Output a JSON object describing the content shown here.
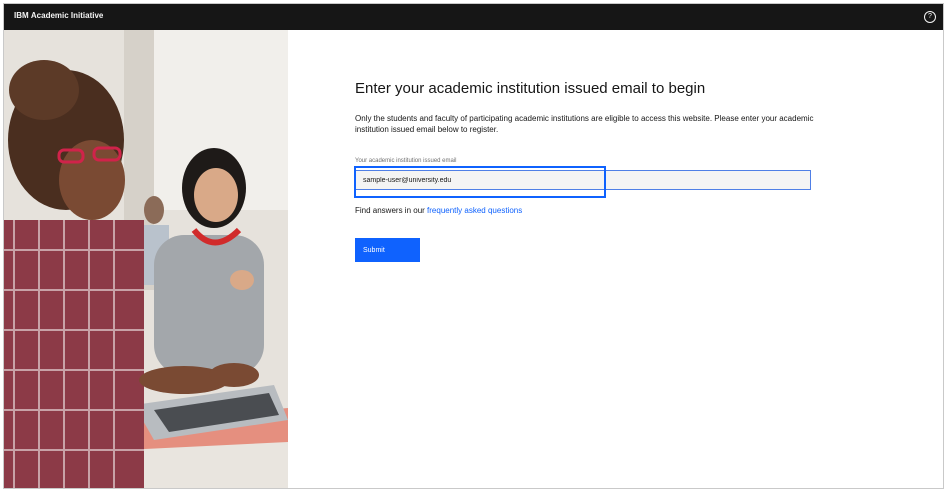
{
  "header": {
    "brand_ibm": "IBM",
    "brand_name": "Academic Initiative",
    "help_icon": "help-circle-icon",
    "help_glyph": "?"
  },
  "hero_image": {
    "description_icon": "students-with-laptop-photo"
  },
  "form": {
    "title": "Enter your academic institution issued email to begin",
    "description": "Only the students and faculty of participating academic institutions are eligible to access this website. Please enter your academic institution issued email below to register.",
    "email_label": "Your academic institution issued email",
    "email_value": "sample-user@university.edu",
    "faq_prefix": "Find answers in our",
    "faq_link": "frequently asked questions",
    "submit_label": "Submit"
  },
  "colors": {
    "topbar": "#161616",
    "primary": "#0f62fe",
    "input_bg": "#f4f4f4"
  }
}
